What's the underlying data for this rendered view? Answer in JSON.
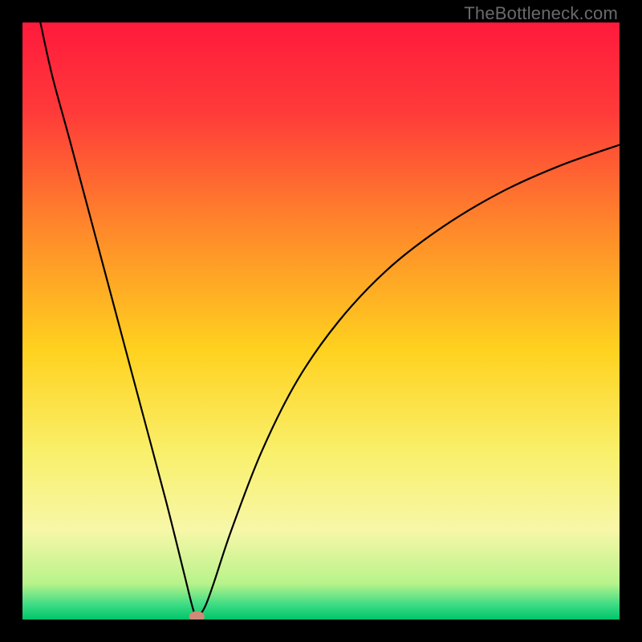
{
  "watermark": "TheBottleneck.com",
  "chart_data": {
    "type": "line",
    "title": "",
    "xlabel": "",
    "ylabel": "",
    "xlim": [
      0,
      100
    ],
    "ylim": [
      0,
      100
    ],
    "grid": false,
    "legend": false,
    "background_gradient_stops": [
      {
        "pos": 0.0,
        "color": "#ff1a3c"
      },
      {
        "pos": 0.15,
        "color": "#ff3a3a"
      },
      {
        "pos": 0.35,
        "color": "#ff8a2a"
      },
      {
        "pos": 0.55,
        "color": "#ffd21f"
      },
      {
        "pos": 0.72,
        "color": "#f9f06b"
      },
      {
        "pos": 0.85,
        "color": "#f7f7a8"
      },
      {
        "pos": 0.94,
        "color": "#b8f38a"
      },
      {
        "pos": 0.975,
        "color": "#3ddc84"
      },
      {
        "pos": 1.0,
        "color": "#00c46a"
      }
    ],
    "series": [
      {
        "name": "bottleneck-curve",
        "stroke": "#000000",
        "stroke_width": 2.2,
        "points": [
          {
            "x": 3.0,
            "y": 100.0
          },
          {
            "x": 5.0,
            "y": 91.0
          },
          {
            "x": 8.0,
            "y": 80.0
          },
          {
            "x": 12.0,
            "y": 65.0
          },
          {
            "x": 16.0,
            "y": 50.0
          },
          {
            "x": 20.0,
            "y": 35.0
          },
          {
            "x": 24.0,
            "y": 20.0
          },
          {
            "x": 27.0,
            "y": 8.0
          },
          {
            "x": 28.5,
            "y": 2.0
          },
          {
            "x": 29.2,
            "y": 0.5
          },
          {
            "x": 30.5,
            "y": 2.0
          },
          {
            "x": 32.0,
            "y": 6.0
          },
          {
            "x": 35.0,
            "y": 15.0
          },
          {
            "x": 40.0,
            "y": 28.0
          },
          {
            "x": 46.0,
            "y": 40.0
          },
          {
            "x": 53.0,
            "y": 50.0
          },
          {
            "x": 61.0,
            "y": 58.5
          },
          {
            "x": 70.0,
            "y": 65.5
          },
          {
            "x": 80.0,
            "y": 71.5
          },
          {
            "x": 90.0,
            "y": 76.0
          },
          {
            "x": 100.0,
            "y": 79.5
          }
        ]
      }
    ],
    "marker": {
      "x": 29.2,
      "y": 0.5,
      "rx": 1.3,
      "ry": 0.9,
      "fill": "#cf8a78"
    }
  }
}
